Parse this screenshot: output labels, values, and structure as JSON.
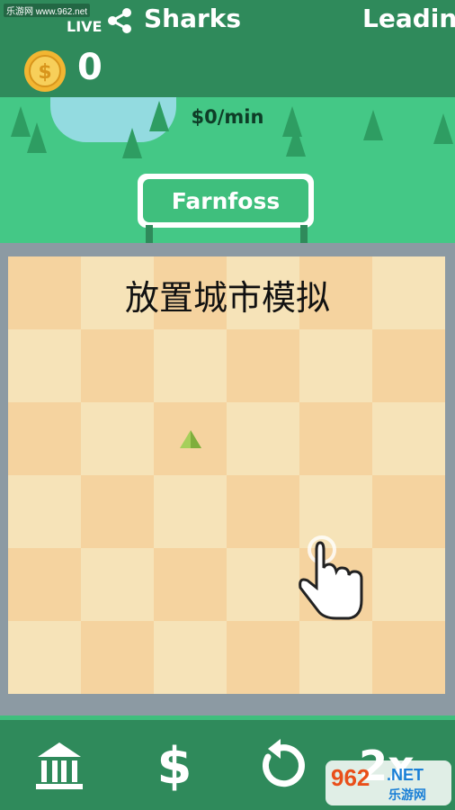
{
  "header": {
    "watermark": "乐游网 www.962.net",
    "live_label": "LIVE",
    "team_name": "Sharks",
    "leaderboard_label": "Leading",
    "coin_count": "0"
  },
  "scene": {
    "income_rate": "$0/min",
    "town_name": "Farnfoss"
  },
  "board": {
    "overlay_title": "放置城市模拟",
    "rows": 6,
    "cols": 6
  },
  "toolbar": {
    "buy_symbol": "$",
    "speed_label": "2x"
  },
  "footer_logo": {
    "number": "962",
    "net": ".NET",
    "sub": "乐游网"
  },
  "colors": {
    "header_green": "#2f8a5b",
    "grass_green": "#44c886",
    "tile_light": "#f6e3b8",
    "tile_dark": "#f5d39f",
    "coin_gold": "#f2b632"
  }
}
